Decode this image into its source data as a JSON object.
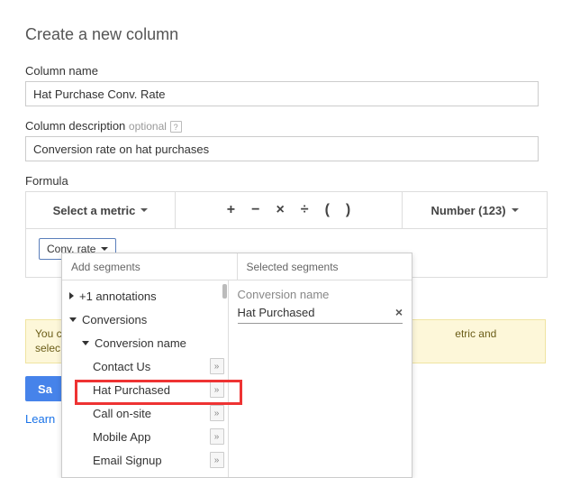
{
  "page_title": "Create a new column",
  "fields": {
    "column_name": {
      "label": "Column name",
      "value": "Hat Purchase Conv. Rate"
    },
    "column_desc": {
      "label": "Column description",
      "optional": "optional",
      "help": "?",
      "value": "Conversion rate on hat purchases"
    },
    "formula": {
      "label": "Formula"
    }
  },
  "formula_bar": {
    "metric_label": "Select a metric",
    "ops": {
      "plus": "+",
      "minus": "−",
      "times": "×",
      "divide": "÷",
      "lparen": "(",
      "rparen": ")"
    },
    "format_label": "Number (123)"
  },
  "formula_body": {
    "pill_label": "Conv. rate"
  },
  "popover": {
    "add_title": "Add segments",
    "sel_title": "Selected segments",
    "tree": {
      "annotations": "+1 annotations",
      "conversions": "Conversions",
      "conv_name": "Conversion name",
      "leaves": {
        "contact_us": "Contact Us",
        "hat_purchased": "Hat Purchased",
        "call_onsite": "Call on-site",
        "mobile_app": "Mobile App",
        "email_signup": "Email Signup"
      },
      "chev": "»"
    },
    "selected": {
      "label": "Conversion name",
      "value": "Hat Purchased",
      "remove": "×"
    }
  },
  "hint": {
    "line1_left": "You c",
    "line1_right": "etric and",
    "line2": "selec"
  },
  "buttons": {
    "save_partial": "Sa"
  },
  "links": {
    "learn_partial": "Learn"
  }
}
